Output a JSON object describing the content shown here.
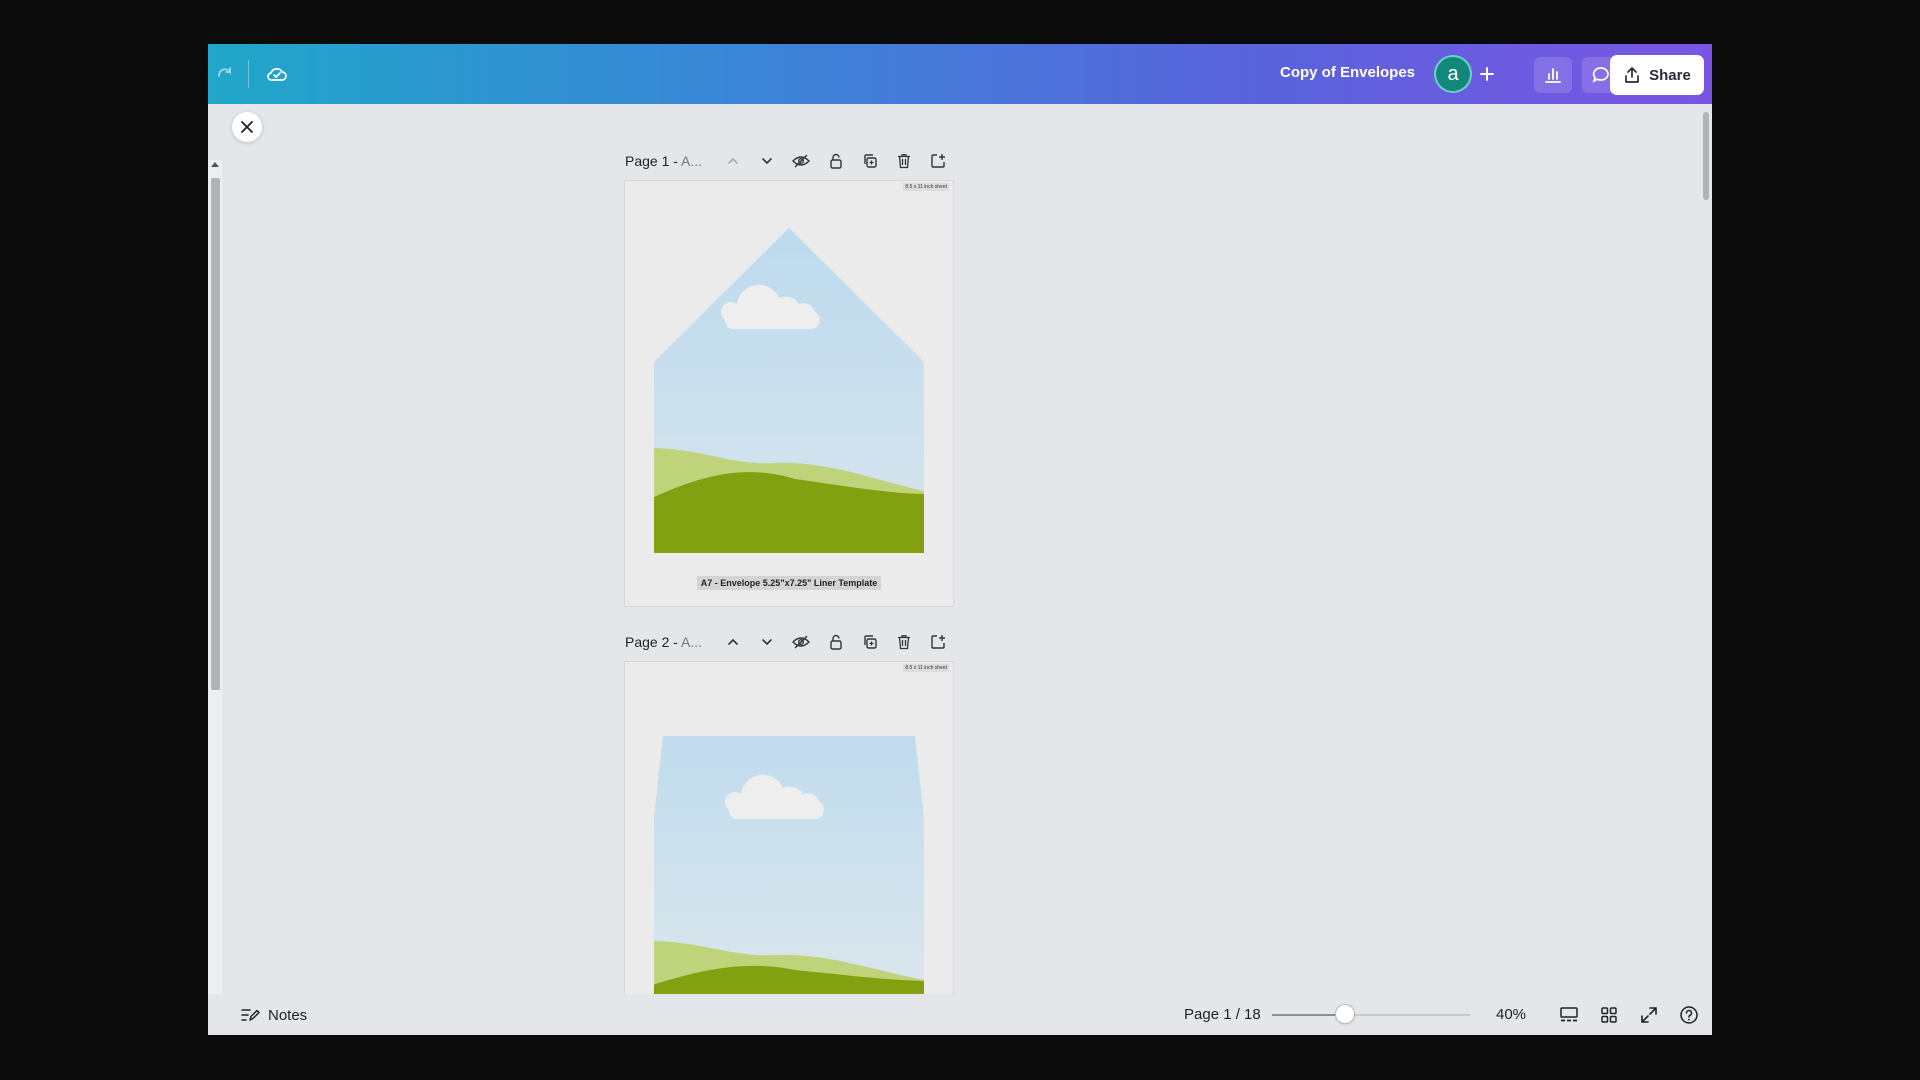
{
  "topbar": {
    "document_title": "Copy of Envelopes",
    "avatar_letter": "a",
    "share_label": "Share",
    "icons": [
      "redo-icon",
      "cloud-sync-icon",
      "add-icon",
      "insights-icon",
      "comment-icon",
      "share-icon"
    ]
  },
  "pages": [
    {
      "label": "Page 1 - ",
      "sub": "A...",
      "sheet_tag": "8.5 x 11 inch sheet",
      "liner_label": "A7 - Envelope 5.25\"x7.25\" Liner Template"
    },
    {
      "label": "Page 2 - ",
      "sub": "A...",
      "sheet_tag": "8.5 x 11 inch sheet"
    }
  ],
  "page_actions": [
    "move-up-icon",
    "move-down-icon",
    "hide-icon",
    "lock-icon",
    "duplicate-icon",
    "delete-icon",
    "add-page-icon"
  ],
  "bottombar": {
    "notes_label": "Notes",
    "page_indicator": "Page 1 / 18",
    "zoom_percent": 40,
    "zoom_label": "40%",
    "zoom_slider_fraction": 0.37
  },
  "colors": {
    "sky": "#c9e0ee",
    "grass_light": "#bfd37a",
    "grass_dark": "#82a010",
    "cloud": "#eeeeee"
  }
}
